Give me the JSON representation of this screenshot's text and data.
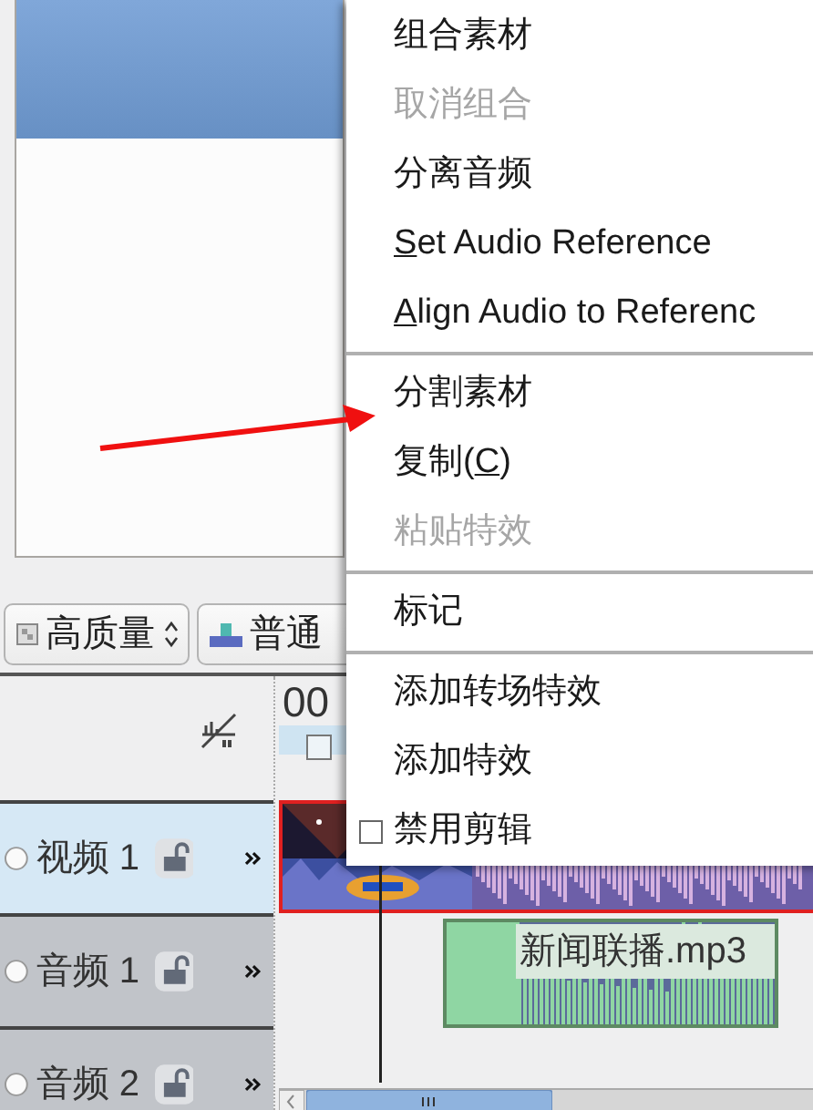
{
  "toolbar": {
    "combos": [
      {
        "label": "高质量",
        "kind": "quality"
      },
      {
        "label": "普通",
        "kind": "view"
      }
    ]
  },
  "timeline": {
    "ruler": {
      "timecode": "00"
    },
    "tracks": [
      {
        "name": "视频 1",
        "selected": true
      },
      {
        "name": "音频 1",
        "selected": false
      },
      {
        "name": "音频 2",
        "selected": false
      }
    ],
    "clips": [
      {
        "kind": "video",
        "selected": true
      },
      {
        "kind": "audio",
        "selected": false,
        "label": "新闻联播.mp3"
      }
    ]
  },
  "context_menu": {
    "items": [
      {
        "kind": "item",
        "label": "组合素材",
        "disabled": false
      },
      {
        "kind": "item",
        "label": "取消组合",
        "disabled": true
      },
      {
        "kind": "item",
        "label": "分离音频",
        "disabled": false
      },
      {
        "kind": "mnemonic",
        "key": "S",
        "after": "et Audio Reference",
        "disabled": false
      },
      {
        "kind": "mnemonic",
        "key": "A",
        "after": "lign Audio to Referenc",
        "disabled": false
      },
      {
        "kind": "separator"
      },
      {
        "kind": "item",
        "label": "分割素材",
        "disabled": false
      },
      {
        "kind": "mnemonic",
        "before": "复制(",
        "key": "C",
        "after": ")",
        "disabled": false
      },
      {
        "kind": "item",
        "label": "粘贴特效",
        "disabled": true
      },
      {
        "kind": "separator"
      },
      {
        "kind": "item",
        "label": "标记",
        "disabled": false
      },
      {
        "kind": "separator"
      },
      {
        "kind": "item",
        "label": "添加转场特效",
        "disabled": false
      },
      {
        "kind": "item",
        "label": "添加特效",
        "disabled": false
      },
      {
        "kind": "check",
        "label": "禁用剪辑",
        "disabled": false,
        "checked": false
      }
    ]
  }
}
